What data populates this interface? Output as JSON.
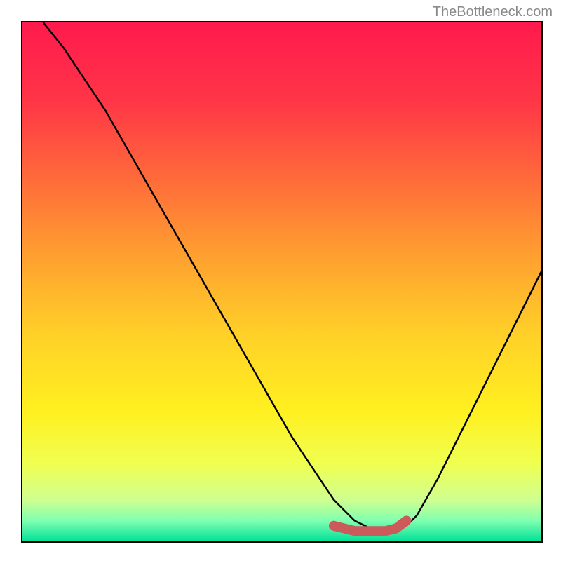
{
  "attribution": "TheBottleneck.com",
  "chart_data": {
    "type": "line",
    "title": "",
    "xlabel": "",
    "ylabel": "",
    "xlim": [
      0,
      100
    ],
    "ylim": [
      0,
      100
    ],
    "series": [
      {
        "name": "bottleneck-curve",
        "x": [
          4,
          8,
          12,
          16,
          20,
          24,
          28,
          32,
          36,
          40,
          44,
          48,
          52,
          56,
          60,
          62,
          64,
          66,
          68,
          70,
          72,
          74,
          76,
          80,
          84,
          88,
          92,
          96,
          100
        ],
        "y": [
          100,
          95,
          89,
          83,
          76,
          69,
          62,
          55,
          48,
          41,
          34,
          27,
          20,
          14,
          8,
          6,
          4,
          3,
          2,
          2,
          2,
          3,
          5,
          12,
          20,
          28,
          36,
          44,
          52
        ]
      }
    ],
    "highlight": {
      "name": "optimal-range",
      "color": "#cc5a5a",
      "x": [
        60,
        62,
        64,
        66,
        68,
        70,
        72,
        74
      ],
      "y": [
        3,
        2.5,
        2,
        2,
        2,
        2,
        2.5,
        4
      ]
    },
    "background_gradient": {
      "stops": [
        {
          "offset": 0,
          "color": "#ff1a4d"
        },
        {
          "offset": 15,
          "color": "#ff3547"
        },
        {
          "offset": 30,
          "color": "#ff6a3a"
        },
        {
          "offset": 45,
          "color": "#ffa030"
        },
        {
          "offset": 60,
          "color": "#ffd028"
        },
        {
          "offset": 75,
          "color": "#fff020"
        },
        {
          "offset": 85,
          "color": "#f0ff50"
        },
        {
          "offset": 92,
          "color": "#d0ff90"
        },
        {
          "offset": 96,
          "color": "#80ffb0"
        },
        {
          "offset": 100,
          "color": "#00e098"
        }
      ]
    }
  }
}
